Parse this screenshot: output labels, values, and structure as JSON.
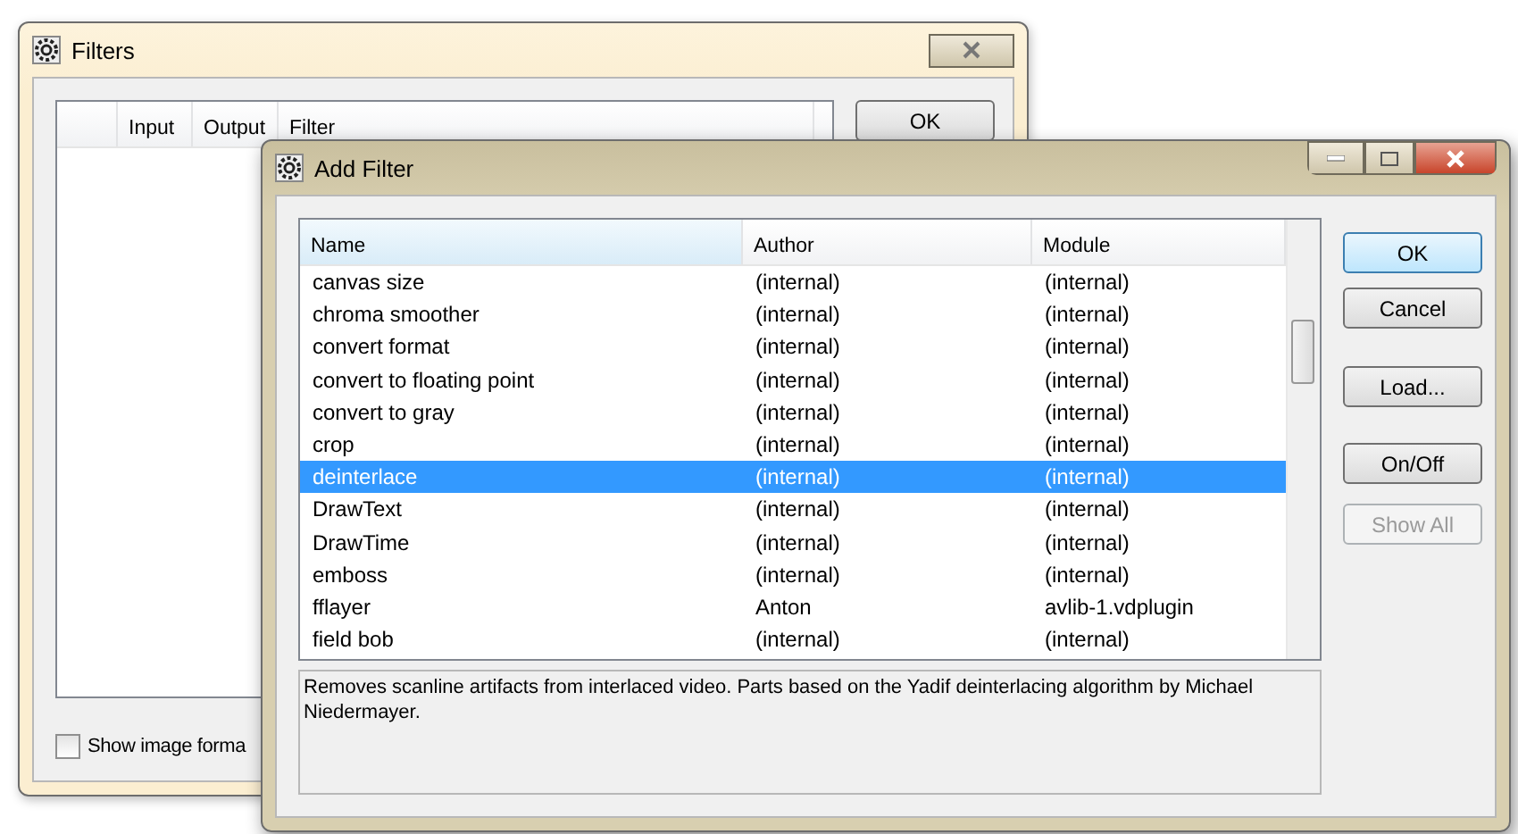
{
  "filters_window": {
    "title": "Filters",
    "columns": [
      "Input",
      "Output",
      "Filter"
    ],
    "buttons": [
      "OK"
    ],
    "checkbox": {
      "label": "Show image forma",
      "checked": false
    }
  },
  "add_filter_window": {
    "title": "Add Filter",
    "columns": [
      "Name",
      "Author",
      "Module"
    ],
    "rows": [
      {
        "name": "canvas size",
        "author": "(internal)",
        "module": "(internal)",
        "selected": false
      },
      {
        "name": "chroma smoother",
        "author": "(internal)",
        "module": "(internal)",
        "selected": false
      },
      {
        "name": "convert format",
        "author": "(internal)",
        "module": "(internal)",
        "selected": false
      },
      {
        "name": "convert to floating point",
        "author": "(internal)",
        "module": "(internal)",
        "selected": false
      },
      {
        "name": "convert to gray",
        "author": "(internal)",
        "module": "(internal)",
        "selected": false
      },
      {
        "name": "crop",
        "author": "(internal)",
        "module": "(internal)",
        "selected": false
      },
      {
        "name": "deinterlace",
        "author": "(internal)",
        "module": "(internal)",
        "selected": true
      },
      {
        "name": "DrawText",
        "author": "(internal)",
        "module": "(internal)",
        "selected": false
      },
      {
        "name": "DrawTime",
        "author": "(internal)",
        "module": "(internal)",
        "selected": false
      },
      {
        "name": "emboss",
        "author": "(internal)",
        "module": "(internal)",
        "selected": false
      },
      {
        "name": "fflayer",
        "author": "Anton",
        "module": "avlib-1.vdplugin",
        "selected": false
      },
      {
        "name": "field bob",
        "author": "(internal)",
        "module": "(internal)",
        "selected": false
      }
    ],
    "buttons": [
      {
        "label": "OK",
        "default": true,
        "disabled": false
      },
      {
        "label": "Cancel",
        "default": false,
        "disabled": false
      },
      {
        "label": "Load...",
        "default": false,
        "disabled": false
      },
      {
        "label": "On/Off",
        "default": false,
        "disabled": false
      },
      {
        "label": "Show All",
        "default": false,
        "disabled": true
      }
    ],
    "description": "Removes scanline artifacts from interlaced video. Parts based on the Yadif deinterlacing algorithm by Michael Niedermayer."
  }
}
